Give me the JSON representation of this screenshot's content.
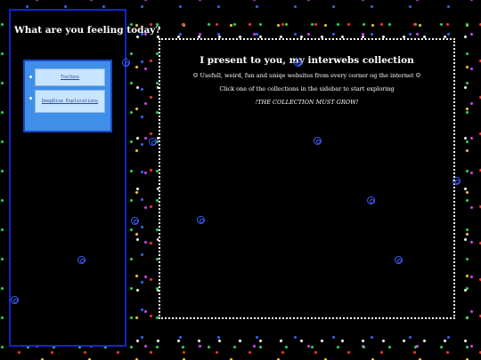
{
  "sidebar": {
    "title": "What are you feeling today?",
    "items": [
      {
        "label": "Toolbox"
      },
      {
        "label": "DeepDive Exploration◎"
      }
    ]
  },
  "main": {
    "heading": "I present to you, my interwebs collection",
    "description": "☺ Usefull, weird, fun and uniqe websites from every corner og the internet ☺",
    "instruction": "Click one of the collections in the sidebar to start exploring",
    "tagline": "!THE COLLECTION MUST GROW!"
  },
  "colors": {
    "sidebar_border": "#1424c8",
    "nav_box_background": "#3f8fe8",
    "link_button_background": "#c8e4ff",
    "swirl": "#3a5cff"
  },
  "icons": [
    "spiral-icon"
  ]
}
